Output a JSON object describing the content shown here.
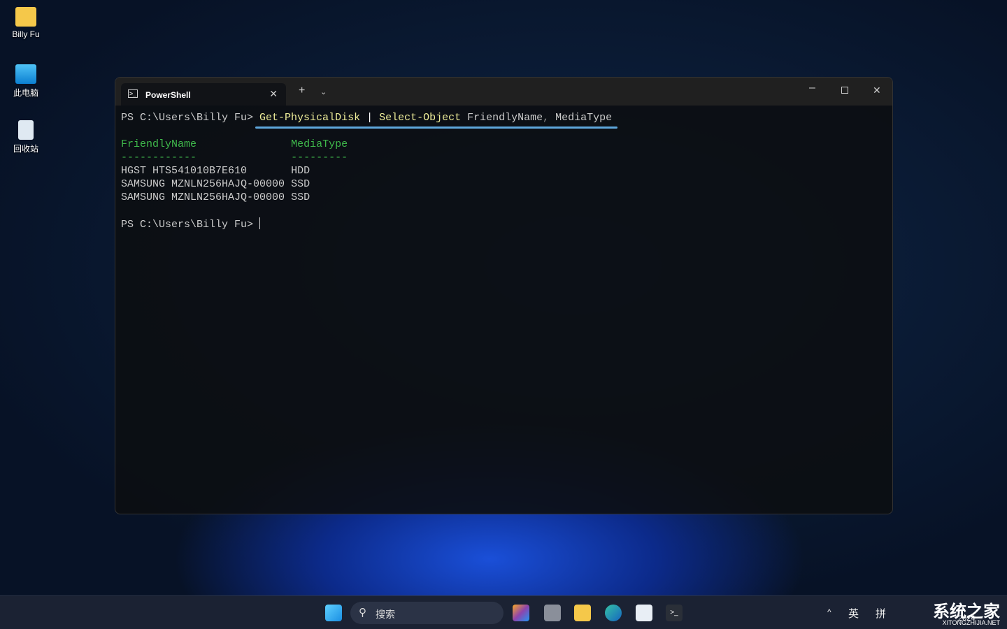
{
  "desktop": {
    "icons": [
      {
        "label": "Billy Fu",
        "icon": "folder-icon"
      },
      {
        "label": "此电脑",
        "icon": "computer-icon"
      },
      {
        "label": "回收站",
        "icon": "recycle-bin-icon"
      }
    ]
  },
  "terminal": {
    "tab_title": "PowerShell",
    "prompt": "PS C:\\Users\\Billy Fu> ",
    "command": {
      "cmd1": "Get-PhysicalDisk",
      "pipe": " | ",
      "cmd2": "Select-Object",
      "arg1": " FriendlyName",
      "comma": ",",
      "arg2": " MediaType"
    },
    "headers": {
      "h1": "FriendlyName",
      "h2": "MediaType",
      "u1": "------------",
      "u2": "---------"
    },
    "rows": [
      {
        "name": "HGST HTS541010B7E610      ",
        "type": "HDD"
      },
      {
        "name": "SAMSUNG MZNLN256HAJQ-00000",
        "type": "SSD"
      },
      {
        "name": "SAMSUNG MZNLN256HAJQ-00000",
        "type": "SSD"
      }
    ],
    "prompt2": "PS C:\\Users\\Billy Fu> "
  },
  "taskbar": {
    "search_placeholder": "搜索",
    "tray": {
      "lang1": "英",
      "lang2": "拼",
      "time": "2024"
    }
  },
  "watermark": {
    "title": "系统之家",
    "url": "XITONGZHIJIA.NET"
  }
}
